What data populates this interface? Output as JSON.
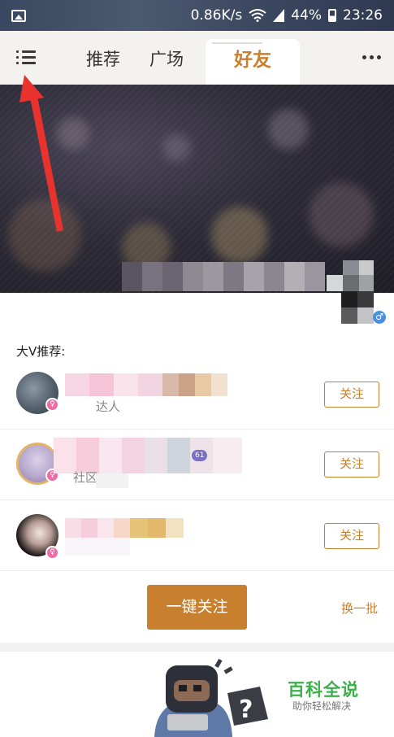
{
  "status_bar": {
    "speed": "0.86K/s",
    "battery": "44%",
    "time": "23:26"
  },
  "nav": {
    "tabs": [
      "推荐",
      "广场",
      "好友"
    ],
    "active_tab": "好友"
  },
  "recommend": {
    "title": "大V推荐:",
    "rows": [
      {
        "desc": "达人",
        "follow_label": "关注",
        "level": ""
      },
      {
        "desc": "社区",
        "follow_label": "关注",
        "level": "61"
      },
      {
        "desc": "",
        "follow_label": "关注",
        "level": ""
      }
    ],
    "follow_all_label": "一键关注",
    "refresh_label": "换一批"
  },
  "watermark": {
    "title": "百科全说",
    "subtitle": "助你轻松解决"
  },
  "colors": {
    "accent": "#c8802e",
    "watermark_green": "#3cb04a",
    "annotation_arrow": "#e8322e"
  }
}
